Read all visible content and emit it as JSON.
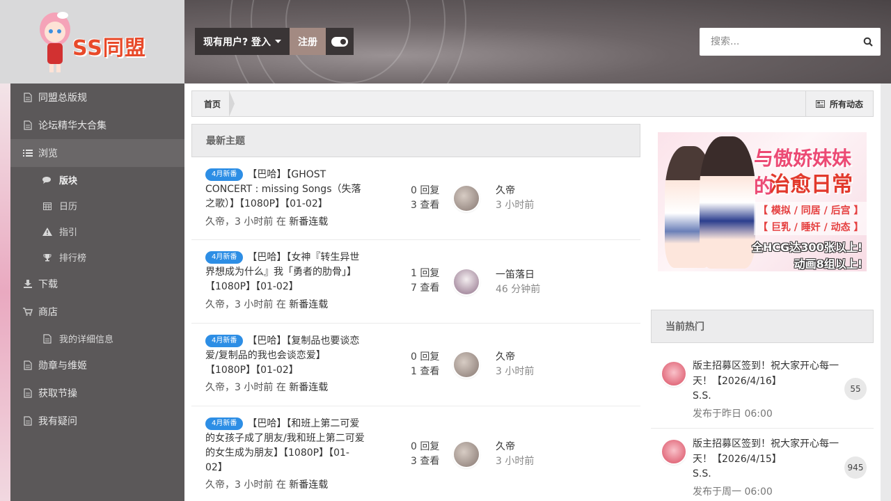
{
  "site": {
    "logo_text": "SS同盟",
    "brand_color": "#e84a2a"
  },
  "userbar": {
    "login_label": "现有用户? 登入",
    "register_label": "注册",
    "theme_toggle_icon": "toggle-icon"
  },
  "search": {
    "placeholder": "搜索...",
    "icon": "search-icon"
  },
  "sidebar": {
    "items": [
      {
        "label": "同盟总版规",
        "icon": "document-icon"
      },
      {
        "label": "论坛精华大合集",
        "icon": "document-icon"
      },
      {
        "label": "浏览",
        "icon": "list-icon"
      },
      {
        "label": "版块",
        "icon": "comments-icon"
      },
      {
        "label": "日历",
        "icon": "calendar-icon"
      },
      {
        "label": "指引",
        "icon": "warning-icon"
      },
      {
        "label": "排行榜",
        "icon": "trophy-icon"
      },
      {
        "label": "下载",
        "icon": "download-icon"
      },
      {
        "label": "商店",
        "icon": "cart-icon"
      },
      {
        "label": "我的详细信息",
        "icon": "document-icon"
      },
      {
        "label": "勋章与维姬",
        "icon": "document-icon"
      },
      {
        "label": "获取节操",
        "icon": "document-icon"
      },
      {
        "label": "我有疑问",
        "icon": "document-icon"
      }
    ]
  },
  "breadcrumb": {
    "home": "首页",
    "all_activity": "所有动态"
  },
  "latest": {
    "heading": "最新主题",
    "topics": [
      {
        "badge": "4月新番",
        "title": "【巴哈】【GHOST CONCERT : missing Songs（失落之歌）】【1080P】【01-02】",
        "author": "久帝",
        "time": "3 小时前",
        "in": "在",
        "forum": "新番连载",
        "replies": "0 回复",
        "views": "3 查看",
        "last_user": "久帝",
        "last_time": "3 小时前"
      },
      {
        "badge": "4月新番",
        "title": "【巴哈】【女神『转生异世界想成为什么』我「勇者的肋骨」】【1080P】【01-02】",
        "author": "久帝",
        "time": "3 小时前",
        "in": "在",
        "forum": "新番连载",
        "replies": "1 回复",
        "views": "7 查看",
        "last_user": "一笛落日",
        "last_time": "46 分钟前"
      },
      {
        "badge": "4月新番",
        "title": "【巴哈】【复制品也要谈恋爱/复制品的我也会谈恋爱】【1080P】【01-02】",
        "author": "久帝",
        "time": "3 小时前",
        "in": "在",
        "forum": "新番连载",
        "replies": "0 回复",
        "views": "1 查看",
        "last_user": "久帝",
        "last_time": "3 小时前"
      },
      {
        "badge": "4月新番",
        "title": "【巴哈】【和班上第二可爱的女孩子成了朋友/我和班上第二可爱的女生成为朋友】【1080P】【01-02】",
        "author": "久帝",
        "time": "3 小时前",
        "in": "在",
        "forum": "新番连载",
        "replies": "0 回复",
        "views": "3 查看",
        "last_user": "久帝",
        "last_time": "3 小时前"
      }
    ]
  },
  "ad": {
    "title_line1": "与傲娇妹妹的",
    "title_line2": "治愈日常",
    "tag1": "【 模拟 / 同居 / 后宫 】",
    "tag2": "【 巨乳 / 睡奸 / 动态 】",
    "bottom1": "全HCG达300张以上!",
    "bottom2": "动画8组以上!"
  },
  "hot": {
    "heading": "当前热门",
    "items": [
      {
        "title": "版主招募区签到！祝大家开心每一天！【2026/4/16】",
        "author": "S.S.",
        "time": "发布于昨日 06:00",
        "count": "55"
      },
      {
        "title": "版主招募区签到！祝大家开心每一天！【2026/4/15】",
        "author": "S.S.",
        "time": "发布于周一 06:00",
        "count": "945"
      }
    ]
  }
}
